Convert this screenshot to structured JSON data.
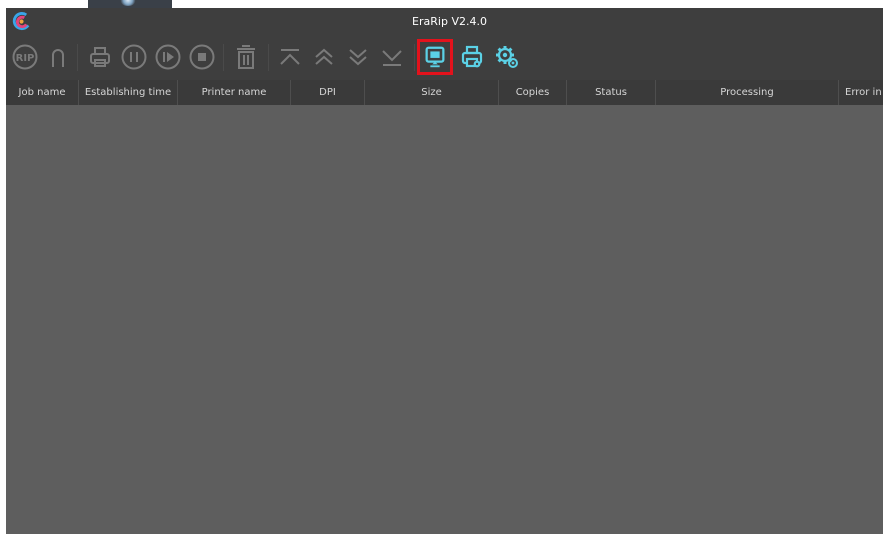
{
  "window": {
    "title": "EraRip V2.4.0"
  },
  "toolbar": {
    "buttons": [
      {
        "icon": "rip-icon",
        "state": "disabled"
      },
      {
        "icon": "magnet-icon",
        "state": "disabled"
      },
      {
        "icon": "print-icon",
        "state": "disabled"
      },
      {
        "icon": "pause-icon",
        "state": "disabled"
      },
      {
        "icon": "play-icon",
        "state": "disabled"
      },
      {
        "icon": "stop-icon",
        "state": "disabled"
      },
      {
        "icon": "delete-icon",
        "state": "disabled"
      },
      {
        "icon": "move-top-icon",
        "state": "disabled"
      },
      {
        "icon": "move-up-icon",
        "state": "disabled"
      },
      {
        "icon": "move-down-icon",
        "state": "disabled"
      },
      {
        "icon": "move-bottom-icon",
        "state": "disabled"
      },
      {
        "icon": "monitor-icon",
        "state": "active-highlighted"
      },
      {
        "icon": "printer-settings-icon",
        "state": "active"
      },
      {
        "icon": "gear-icon",
        "state": "active"
      }
    ],
    "rip_text": "RIP"
  },
  "table": {
    "columns": [
      "Job name",
      "Establishing time",
      "Printer name",
      "DPI",
      "Size",
      "Copies",
      "Status",
      "Processing",
      "Error in"
    ],
    "rows": []
  },
  "colors": {
    "titlebar": "#3e3e3e",
    "header": "#3a3a3a",
    "body": "#5e5e5e",
    "disabled_icon": "#7a7a7a",
    "accent_icon": "#5bd1e6",
    "highlight": "#e3121c"
  }
}
